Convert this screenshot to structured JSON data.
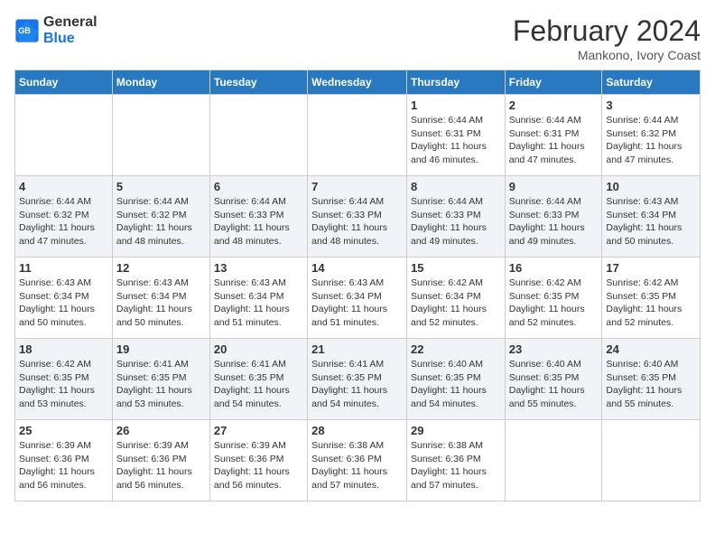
{
  "header": {
    "logo_line1": "General",
    "logo_line2": "Blue",
    "month_year": "February 2024",
    "location": "Mankono, Ivory Coast"
  },
  "days_of_week": [
    "Sunday",
    "Monday",
    "Tuesday",
    "Wednesday",
    "Thursday",
    "Friday",
    "Saturday"
  ],
  "weeks": [
    [
      {
        "num": "",
        "info": ""
      },
      {
        "num": "",
        "info": ""
      },
      {
        "num": "",
        "info": ""
      },
      {
        "num": "",
        "info": ""
      },
      {
        "num": "1",
        "info": "Sunrise: 6:44 AM\nSunset: 6:31 PM\nDaylight: 11 hours\nand 46 minutes."
      },
      {
        "num": "2",
        "info": "Sunrise: 6:44 AM\nSunset: 6:31 PM\nDaylight: 11 hours\nand 47 minutes."
      },
      {
        "num": "3",
        "info": "Sunrise: 6:44 AM\nSunset: 6:32 PM\nDaylight: 11 hours\nand 47 minutes."
      }
    ],
    [
      {
        "num": "4",
        "info": "Sunrise: 6:44 AM\nSunset: 6:32 PM\nDaylight: 11 hours\nand 47 minutes."
      },
      {
        "num": "5",
        "info": "Sunrise: 6:44 AM\nSunset: 6:32 PM\nDaylight: 11 hours\nand 48 minutes."
      },
      {
        "num": "6",
        "info": "Sunrise: 6:44 AM\nSunset: 6:33 PM\nDaylight: 11 hours\nand 48 minutes."
      },
      {
        "num": "7",
        "info": "Sunrise: 6:44 AM\nSunset: 6:33 PM\nDaylight: 11 hours\nand 48 minutes."
      },
      {
        "num": "8",
        "info": "Sunrise: 6:44 AM\nSunset: 6:33 PM\nDaylight: 11 hours\nand 49 minutes."
      },
      {
        "num": "9",
        "info": "Sunrise: 6:44 AM\nSunset: 6:33 PM\nDaylight: 11 hours\nand 49 minutes."
      },
      {
        "num": "10",
        "info": "Sunrise: 6:43 AM\nSunset: 6:34 PM\nDaylight: 11 hours\nand 50 minutes."
      }
    ],
    [
      {
        "num": "11",
        "info": "Sunrise: 6:43 AM\nSunset: 6:34 PM\nDaylight: 11 hours\nand 50 minutes."
      },
      {
        "num": "12",
        "info": "Sunrise: 6:43 AM\nSunset: 6:34 PM\nDaylight: 11 hours\nand 50 minutes."
      },
      {
        "num": "13",
        "info": "Sunrise: 6:43 AM\nSunset: 6:34 PM\nDaylight: 11 hours\nand 51 minutes."
      },
      {
        "num": "14",
        "info": "Sunrise: 6:43 AM\nSunset: 6:34 PM\nDaylight: 11 hours\nand 51 minutes."
      },
      {
        "num": "15",
        "info": "Sunrise: 6:42 AM\nSunset: 6:34 PM\nDaylight: 11 hours\nand 52 minutes."
      },
      {
        "num": "16",
        "info": "Sunrise: 6:42 AM\nSunset: 6:35 PM\nDaylight: 11 hours\nand 52 minutes."
      },
      {
        "num": "17",
        "info": "Sunrise: 6:42 AM\nSunset: 6:35 PM\nDaylight: 11 hours\nand 52 minutes."
      }
    ],
    [
      {
        "num": "18",
        "info": "Sunrise: 6:42 AM\nSunset: 6:35 PM\nDaylight: 11 hours\nand 53 minutes."
      },
      {
        "num": "19",
        "info": "Sunrise: 6:41 AM\nSunset: 6:35 PM\nDaylight: 11 hours\nand 53 minutes."
      },
      {
        "num": "20",
        "info": "Sunrise: 6:41 AM\nSunset: 6:35 PM\nDaylight: 11 hours\nand 54 minutes."
      },
      {
        "num": "21",
        "info": "Sunrise: 6:41 AM\nSunset: 6:35 PM\nDaylight: 11 hours\nand 54 minutes."
      },
      {
        "num": "22",
        "info": "Sunrise: 6:40 AM\nSunset: 6:35 PM\nDaylight: 11 hours\nand 54 minutes."
      },
      {
        "num": "23",
        "info": "Sunrise: 6:40 AM\nSunset: 6:35 PM\nDaylight: 11 hours\nand 55 minutes."
      },
      {
        "num": "24",
        "info": "Sunrise: 6:40 AM\nSunset: 6:35 PM\nDaylight: 11 hours\nand 55 minutes."
      }
    ],
    [
      {
        "num": "25",
        "info": "Sunrise: 6:39 AM\nSunset: 6:36 PM\nDaylight: 11 hours\nand 56 minutes."
      },
      {
        "num": "26",
        "info": "Sunrise: 6:39 AM\nSunset: 6:36 PM\nDaylight: 11 hours\nand 56 minutes."
      },
      {
        "num": "27",
        "info": "Sunrise: 6:39 AM\nSunset: 6:36 PM\nDaylight: 11 hours\nand 56 minutes."
      },
      {
        "num": "28",
        "info": "Sunrise: 6:38 AM\nSunset: 6:36 PM\nDaylight: 11 hours\nand 57 minutes."
      },
      {
        "num": "29",
        "info": "Sunrise: 6:38 AM\nSunset: 6:36 PM\nDaylight: 11 hours\nand 57 minutes."
      },
      {
        "num": "",
        "info": ""
      },
      {
        "num": "",
        "info": ""
      }
    ]
  ]
}
